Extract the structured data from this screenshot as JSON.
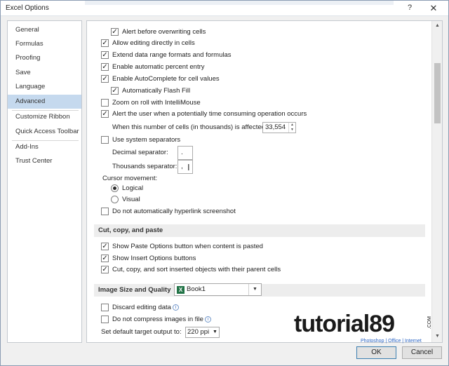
{
  "window": {
    "title": "Excel Options",
    "help_label": "?",
    "close_label": "✕"
  },
  "nav": [
    {
      "label": "General",
      "active": false
    },
    {
      "label": "Formulas",
      "active": false
    },
    {
      "label": "Proofing",
      "active": false
    },
    {
      "label": "Save",
      "active": false
    },
    {
      "label": "Language",
      "active": false
    },
    {
      "label": "Advanced",
      "active": true
    },
    {
      "label": "Customize Ribbon",
      "active": false
    },
    {
      "label": "Quick Access Toolbar",
      "active": false
    },
    {
      "label": "Add-Ins",
      "active": false
    },
    {
      "label": "Trust Center",
      "active": false
    }
  ],
  "editing": {
    "alert_overwrite": {
      "label": "Alert before overwriting cells",
      "checked": true
    },
    "allow_edit_in_cells": {
      "label": "Allow editing directly in cells",
      "checked": true
    },
    "extend_formats": {
      "label": "Extend data range formats and formulas",
      "checked": true
    },
    "auto_percent": {
      "label": "Enable automatic percent entry",
      "checked": true
    },
    "autocomplete": {
      "label": "Enable AutoComplete for cell values",
      "checked": true
    },
    "flash_fill": {
      "label": "Automatically Flash Fill",
      "checked": true
    },
    "zoom_roll": {
      "label": "Zoom on roll with IntelliMouse",
      "checked": false
    },
    "alert_slow_op": {
      "label": "Alert the user when a potentially time consuming operation occurs",
      "checked": true
    },
    "cells_affected": {
      "label": "When this number of cells (in thousands) is affected:",
      "value": "33,554"
    },
    "system_separators": {
      "label": "Use system separators",
      "checked": false
    },
    "decimal_separator": {
      "label": "Decimal separator:",
      "value": "."
    },
    "thousands_separator": {
      "label": "Thousands separator:",
      "value": ","
    },
    "cursor_movement": {
      "label": "Cursor movement:",
      "options": [
        {
          "label": "Logical",
          "selected": true
        },
        {
          "label": "Visual",
          "selected": false
        }
      ]
    },
    "no_hyperlink_screenshot": {
      "label": "Do not automatically hyperlink screenshot",
      "checked": false
    }
  },
  "cut_copy_paste": {
    "heading": "Cut, copy, and paste",
    "show_paste_options": {
      "label": "Show Paste Options button when content is pasted",
      "checked": true
    },
    "show_insert_options": {
      "label": "Show Insert Options buttons",
      "checked": true
    },
    "cut_copy_sort": {
      "label": "Cut, copy, and sort inserted objects with their parent cells",
      "checked": true
    }
  },
  "image_size_quality": {
    "heading": "Image Size and Quality",
    "workbook": "Book1",
    "workbook_icon": "X",
    "discard_editing": {
      "label": "Discard editing data",
      "checked": false
    },
    "no_compress": {
      "label": "Do not compress images in file",
      "checked": false
    },
    "default_output": {
      "label": "Set default target output to:",
      "value": "220 ppi"
    }
  },
  "buttons": {
    "ok": "OK",
    "cancel": "Cancel"
  },
  "watermark": {
    "text": "tutorial89",
    "tagline": "Photoshop | Office | Internet",
    "domain": ".COM"
  }
}
